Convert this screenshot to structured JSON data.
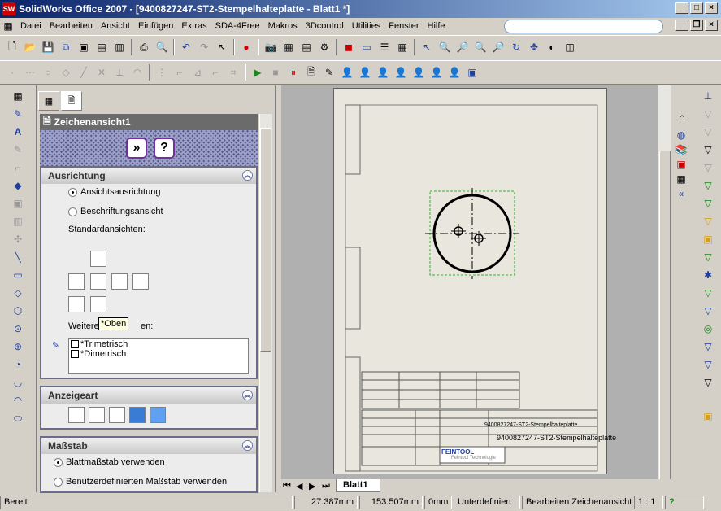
{
  "window": {
    "title": "SolidWorks Office 2007 - [9400827247-ST2-Stempelhalteplatte - Blatt1 *]",
    "app_icon": "SW"
  },
  "menu": [
    "Datei",
    "Bearbeiten",
    "Ansicht",
    "Einfügen",
    "Extras",
    "SDA-4Free",
    "Makros",
    "3Dcontrol",
    "Utilities",
    "Fenster",
    "Hilfe"
  ],
  "property_manager": {
    "title": "Zeichenansicht1",
    "orientation": {
      "header": "Ausrichtung",
      "radio_view_orientation": "Ansichtsausrichtung",
      "radio_named_view": "Beschriftungsansicht",
      "standard_views_label": "Standardansichten:",
      "more_views_label": "Weitere Ansichten:",
      "more_views_prefix": "Weitere",
      "more_views_suffix": "en:",
      "tooltip": "*Oben",
      "views_list": [
        "*Trimetrisch",
        "*Dimetrisch"
      ]
    },
    "display": {
      "header": "Anzeigeart"
    },
    "scale": {
      "header": "Maßstab",
      "radio_sheet_scale": "Blattmaßstab verwenden",
      "radio_custom_scale": "Benutzerdefinierten Maßstab verwenden"
    }
  },
  "drawing": {
    "sheet_tab": "Blatt1",
    "title_block_title": "9400827247-ST2-Stempelhalteplatte",
    "title_block_small": "9400827247-ST2-Stempelhalteplatte",
    "logo": "FEINTOOL",
    "logo_sub": "Feintool Technologie"
  },
  "status": {
    "ready": "Bereit",
    "x": "27.387mm",
    "y": "153.507mm",
    "z": "0mm",
    "state": "Unterdefiniert",
    "mode": "Bearbeiten Zeichenansicht1",
    "scale": "1 : 1",
    "help": "?"
  },
  "colors": {
    "title_bar_start": "#0a246a",
    "title_bar_end": "#a6caf0",
    "property_header": "#6b6b6b",
    "check_pattern": "#5a5a8a",
    "accent_purple": "#7030a0",
    "viewport_bg": "#b0b0b0",
    "sheet_bg": "#e8e6dd",
    "selection_green": "#2bb52b"
  }
}
